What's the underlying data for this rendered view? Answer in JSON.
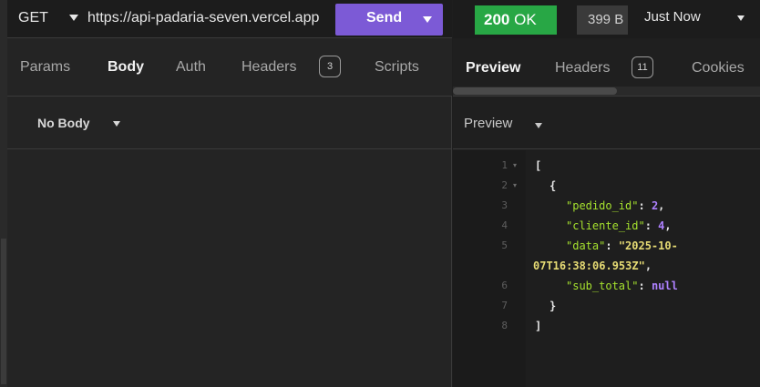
{
  "request": {
    "method": "GET",
    "url": "https://api-padaria-seven.vercel.app",
    "send_label": "Send",
    "tabs": [
      {
        "label": "Params"
      },
      {
        "label": "Body"
      },
      {
        "label": "Auth"
      },
      {
        "label": "Headers",
        "count": "3"
      },
      {
        "label": "Scripts"
      }
    ],
    "active_tab": "Body",
    "body_mode": "No Body"
  },
  "response": {
    "status_code": "200",
    "status_text": "OK",
    "size": "399 B",
    "time": "Just Now",
    "tabs": [
      {
        "label": "Preview"
      },
      {
        "label": "Headers",
        "count": "11"
      },
      {
        "label": "Cookies"
      }
    ],
    "active_tab": "Preview",
    "preview_mode": "Preview",
    "lines": [
      {
        "num": "1",
        "fold": "▾",
        "parts": [
          {
            "t": "[",
            "c": "punc"
          }
        ]
      },
      {
        "num": "2",
        "fold": "▾",
        "parts": [
          {
            "t": "{",
            "c": "punc"
          }
        ]
      },
      {
        "num": "3",
        "parts": [
          {
            "t": "\"pedido_id\"",
            "c": "key"
          },
          {
            "t": ": ",
            "c": "punc"
          },
          {
            "t": "2",
            "c": "num"
          },
          {
            "t": ",",
            "c": "punc"
          }
        ]
      },
      {
        "num": "4",
        "parts": [
          {
            "t": "\"cliente_id\"",
            "c": "key"
          },
          {
            "t": ": ",
            "c": "punc"
          },
          {
            "t": "4",
            "c": "num"
          },
          {
            "t": ",",
            "c": "punc"
          }
        ]
      },
      {
        "num": "5",
        "parts": [
          {
            "t": "\"data\"",
            "c": "key"
          },
          {
            "t": ": ",
            "c": "punc"
          },
          {
            "t": "\"2025-10-",
            "c": "str"
          }
        ]
      },
      {
        "num": "",
        "parts": [
          {
            "t": "07T16:38:06.953Z\"",
            "c": "str"
          },
          {
            "t": ",",
            "c": "punc"
          }
        ]
      },
      {
        "num": "6",
        "parts": [
          {
            "t": "\"sub_total\"",
            "c": "key"
          },
          {
            "t": ": ",
            "c": "punc"
          },
          {
            "t": "null",
            "c": "lit"
          }
        ]
      },
      {
        "num": "7",
        "parts": [
          {
            "t": "}",
            "c": "punc"
          }
        ]
      },
      {
        "num": "8",
        "parts": [
          {
            "t": "]",
            "c": "punc"
          }
        ]
      }
    ]
  },
  "colors": {
    "send_button": "#7c5ad6",
    "status_ok": "#28a745",
    "json_key": "#a6e22e",
    "json_string": "#e6db74",
    "json_number": "#ae81ff"
  }
}
